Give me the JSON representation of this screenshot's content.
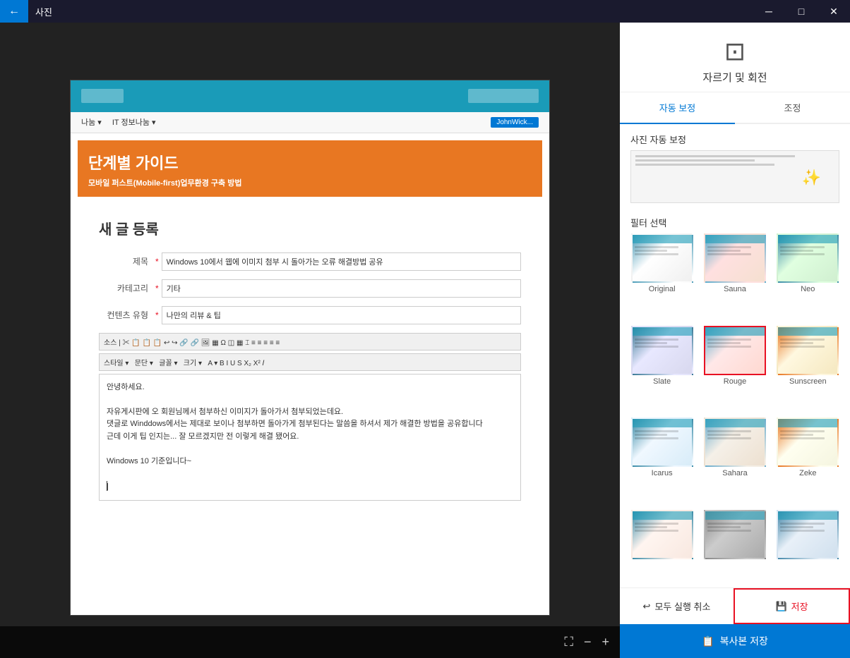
{
  "titlebar": {
    "back_icon": "←",
    "title": "사진",
    "minimize_icon": "─",
    "maximize_icon": "□",
    "close_icon": "✕"
  },
  "panel": {
    "crop_icon": "⊠",
    "title": "자르기 및 회전",
    "tab_auto": "자동 보정",
    "tab_adjust": "조정",
    "auto_section_title": "사진 자동 보정",
    "filter_section_title": "필터 선택",
    "filters": [
      {
        "id": "original",
        "label": "Original",
        "class": "filter-original",
        "selected": false
      },
      {
        "id": "sauna",
        "label": "Sauna",
        "class": "filter-sauna",
        "selected": false
      },
      {
        "id": "neo",
        "label": "Neo",
        "class": "filter-neo",
        "selected": false
      },
      {
        "id": "slate",
        "label": "Slate",
        "class": "filter-slate",
        "selected": false
      },
      {
        "id": "rouge",
        "label": "Rouge",
        "class": "filter-rouge",
        "selected": true
      },
      {
        "id": "sunscreen",
        "label": "Sunscreen",
        "class": "filter-sunscreen",
        "selected": false
      },
      {
        "id": "icarus",
        "label": "Icarus",
        "class": "filter-icarus",
        "selected": false
      },
      {
        "id": "sahara",
        "label": "Sahara",
        "class": "filter-sahara",
        "selected": false
      },
      {
        "id": "zeke",
        "label": "Zeke",
        "class": "filter-zeke",
        "selected": false
      },
      {
        "id": "extra1",
        "label": "",
        "class": "filter-extra1",
        "selected": false
      },
      {
        "id": "extra2",
        "label": "",
        "class": "filter-extra2",
        "selected": false
      },
      {
        "id": "extra3",
        "label": "",
        "class": "filter-extra3",
        "selected": false
      }
    ],
    "undo_icon": "↩",
    "undo_label": "모두 실행 취소",
    "save_icon": "💾",
    "save_label": "저장",
    "copy_icon": "📋",
    "copy_label": "복사본 저장"
  },
  "webpage": {
    "banner_title": "단계별 가이드",
    "banner_subtitle": "모바일 퍼스트(Mobile-first)업무환경 구축 방법",
    "form_title": "새 글 등록",
    "title_label": "제목",
    "title_value": "Windows 10에서 웹에 이미지 첨부 시 돌아가는 오류 해결방법 공유",
    "category_label": "카테고리",
    "category_value": "기타",
    "content_type_label": "컨텐츠 유형",
    "content_type_value": "나만의 리뷰 & 팁",
    "editor_content_line1": "안녕하세요.",
    "editor_content_line2": "자유게시판에 오 회원님께서 첨부하신 이미지가 돌아가서 첨부되었는데요.",
    "editor_content_line3": "댓글로 Winddows에서는 제대로 보이나 첨부하면 돌아가게 첨부된다는 말씀을 하셔서 제가 해결한 방법을 공유합니다",
    "editor_content_line4": "근데 이게 팁 인지는... 잘 모르겠지만 전 이렇게 해결 됐어요.",
    "editor_content_line5": "Windows 10 기준입니다~"
  },
  "bottom_toolbar": {
    "fullscreen_icon": "⛶",
    "minus_icon": "−",
    "plus_icon": "+"
  }
}
